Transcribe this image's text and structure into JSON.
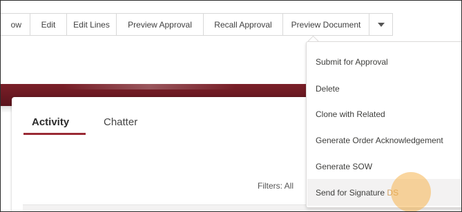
{
  "toolbar": {
    "buttons": [
      "ow",
      "Edit",
      "Edit Lines",
      "Preview Approval",
      "Recall Approval",
      "Preview Document"
    ],
    "more_icon": "chevron-down-icon"
  },
  "tabs": {
    "activity": "Activity",
    "chatter": "Chatter"
  },
  "filters_label": "Filters: All",
  "menu": {
    "items": [
      "Submit for Approval",
      "Delete",
      "Clone with Related",
      "Generate Order Acknowledgement",
      "Generate SOW",
      "Send for Signature"
    ],
    "highlighted_suffix": "DS"
  },
  "colors": {
    "brand_band": "#7b1f28",
    "tab_underline": "#9a2a34",
    "cursor_highlight": "#f5b450"
  }
}
